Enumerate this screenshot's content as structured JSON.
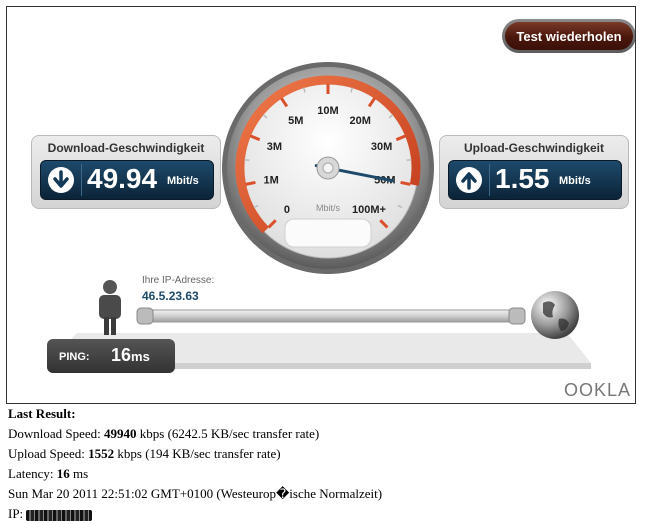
{
  "applet": {
    "retest_label": "Test wiederholen",
    "download": {
      "label": "Download-Geschwindigkeit",
      "value": "49.94",
      "unit": "Mbit/s"
    },
    "upload": {
      "label": "Upload-Geschwindigkeit",
      "value": "1.55",
      "unit": "Mbit/s"
    },
    "gauge": {
      "ticks": [
        "0",
        "1M",
        "3M",
        "5M",
        "10M",
        "20M",
        "30M",
        "50M",
        "100M+"
      ],
      "unit_label": "Mbit/s",
      "needle_value_mbps": 49.94
    },
    "ip": {
      "label": "Ihre IP-Adresse:",
      "value": "46.5.23.63"
    },
    "ping": {
      "label": "PING:",
      "value": "16",
      "unit": "ms"
    },
    "brand": "OOKLA",
    "colors": {
      "accent_red": "#d9502a",
      "panel_blue": "#123a58",
      "button_brown": "#5a1f10"
    }
  },
  "results": {
    "heading": "Last Result:",
    "download_prefix": "Download Speed: ",
    "download_value": "49940",
    "download_suffix": " kbps (6242.5 KB/sec transfer rate)",
    "upload_prefix": "Upload Speed: ",
    "upload_value": "1552",
    "upload_suffix": " kbps (194 KB/sec transfer rate)",
    "latency_prefix": "Latency: ",
    "latency_value": "16",
    "latency_suffix": " ms",
    "date_line": "Sun Mar 20 2011 22:51:02 GMT+0100 (Westeurop�ische Normalzeit)",
    "ip_prefix": "IP: "
  }
}
